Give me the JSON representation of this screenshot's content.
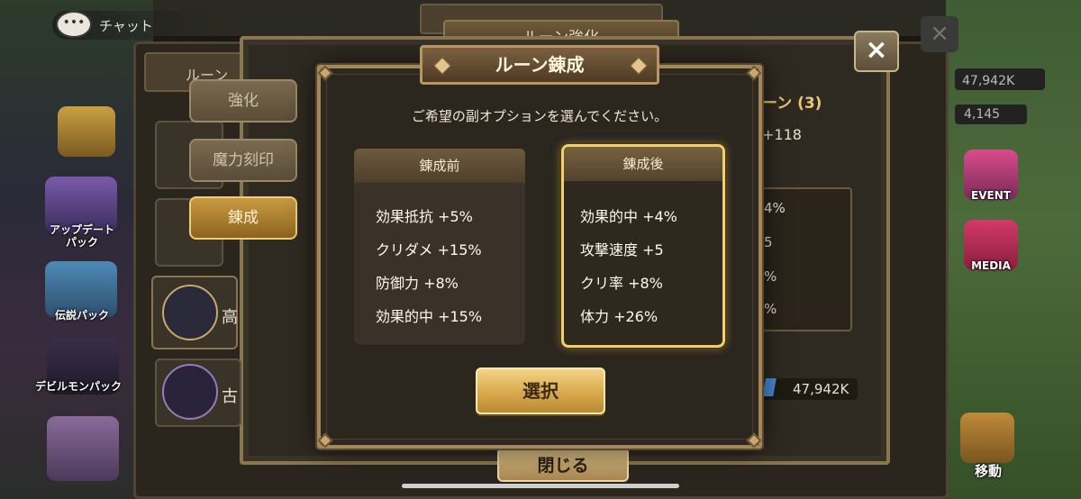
{
  "chat": {
    "label": "チャット"
  },
  "left_side": [
    {
      "label": ""
    },
    {
      "label": "アップデート\nパック"
    },
    {
      "label": "伝説パック"
    },
    {
      "label": "デビルモンパック"
    },
    {
      "label": ""
    }
  ],
  "right_side": {
    "event_label": "EVENT",
    "media_label": "MEDIA",
    "move_label": "移動",
    "currency_1": "2K",
    "currency_2": "47,942K",
    "currency_3": "4,145"
  },
  "background_panel": {
    "title_partial": "ルーン強化",
    "tabs": [
      {
        "label": "強化",
        "active": false
      },
      {
        "label": "魔力刻印",
        "active": false
      },
      {
        "label": "錬成",
        "active": true
      }
    ],
    "rune_header": "ルーン",
    "rune_labels": [
      "高",
      "古"
    ],
    "right_title": "ーン (3)",
    "right_value": "+118",
    "right_stats": [
      "4%",
      "5",
      "%",
      "%"
    ],
    "currency": "47,942K",
    "close_label": "閉じる"
  },
  "modal": {
    "title": "ルーン錬成",
    "subtitle": "ご希望の副オプションを選んでください。",
    "before": {
      "header": "錬成前",
      "options": [
        "効果抵抗 +5%",
        "クリダメ +15%",
        "防御力 +8%",
        "効果的中 +15%"
      ]
    },
    "after": {
      "header": "錬成後",
      "options": [
        "効果的中 +4%",
        "攻撃速度 +5",
        "クリ率 +8%",
        "体力 +26%"
      ]
    },
    "select_label": "選択"
  },
  "close_icon": "×",
  "colors": {
    "accent_gold": "#f0cf6c",
    "button_gold": "#d8a94c",
    "panel_dark": "#2b261e"
  }
}
